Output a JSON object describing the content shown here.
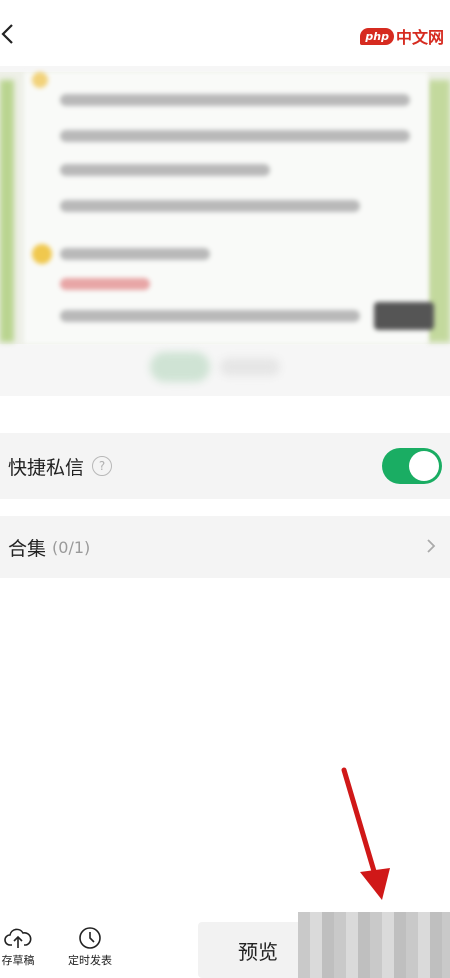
{
  "watermark": {
    "badge": "php",
    "text": "中文网"
  },
  "settings": {
    "quick_message": {
      "label": "快捷私信",
      "help": "?",
      "enabled": true
    },
    "collection": {
      "label": "合集",
      "count": "(0/1)"
    }
  },
  "toolbar": {
    "save_draft_label": "存草稿",
    "schedule_label": "定时发表",
    "preview_label": "预览"
  },
  "colors": {
    "toggle_on": "#1aad63",
    "watermark_red": "#d62b20"
  },
  "icons": {
    "back": "back-chevron",
    "help": "question-circle",
    "chevron": "chevron-right",
    "draft": "cloud-upload",
    "schedule": "clock"
  }
}
